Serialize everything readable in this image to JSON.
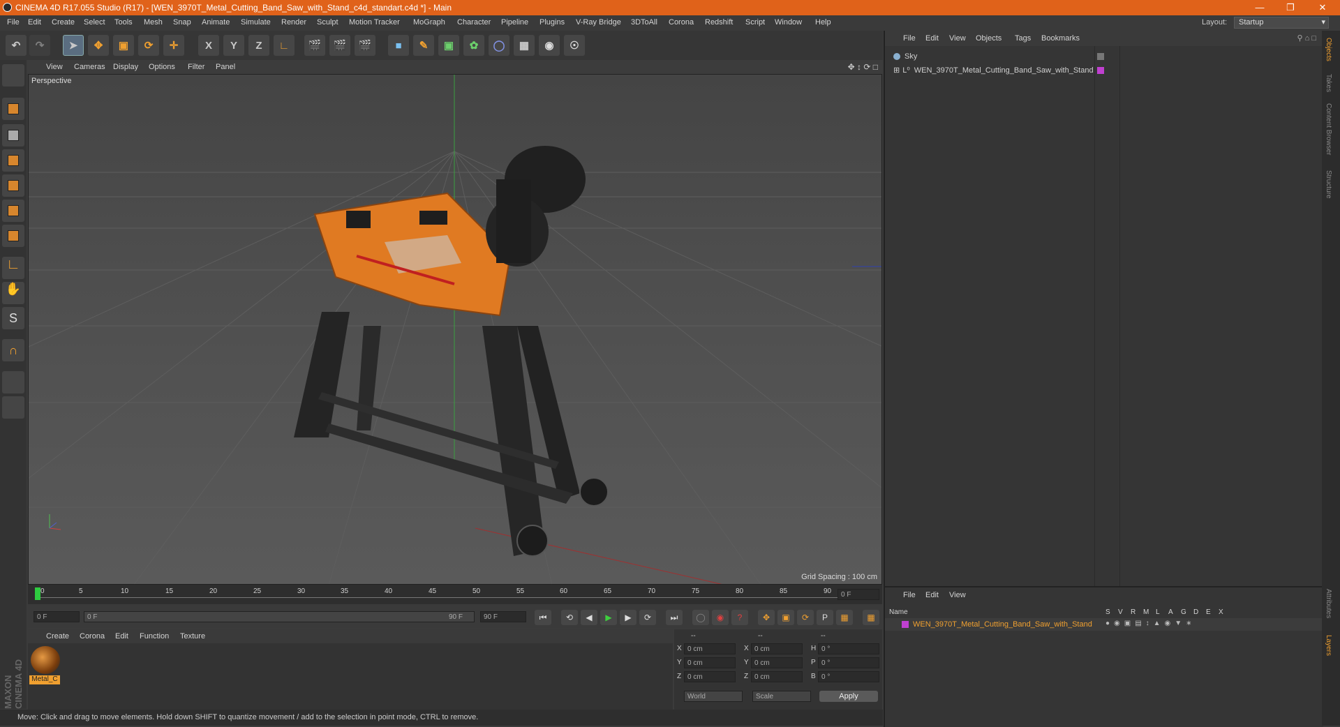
{
  "titlebar": {
    "title": "CINEMA 4D R17.055 Studio (R17) - [WEN_3970T_Metal_Cutting_Band_Saw_with_Stand_c4d_standart.c4d *] - Main",
    "accent": "#e0621a"
  },
  "menubar": {
    "items": [
      "File",
      "Edit",
      "Create",
      "Select",
      "Tools",
      "Mesh",
      "Snap",
      "Animate",
      "Simulate",
      "Render",
      "Sculpt",
      "Motion Tracker",
      "MoGraph",
      "Character",
      "Pipeline",
      "Plugins",
      "V-Ray Bridge",
      "3DToAll",
      "Corona",
      "Redshift",
      "Script",
      "Window",
      "Help"
    ],
    "layout_label": "Layout:",
    "layout_value": "Startup"
  },
  "toolbar": {
    "axis_x": "X",
    "axis_y": "Y",
    "axis_z": "Z"
  },
  "viewport": {
    "menu": [
      "View",
      "Cameras",
      "Display",
      "Options",
      "Filter",
      "Panel"
    ],
    "label": "Perspective",
    "grid_spacing": "Grid Spacing : 100 cm"
  },
  "timeline": {
    "ticks": [
      "0",
      "5",
      "10",
      "15",
      "20",
      "25",
      "30",
      "35",
      "40",
      "45",
      "50",
      "55",
      "60",
      "65",
      "70",
      "75",
      "80",
      "85",
      "90"
    ],
    "current_frame": "0 F",
    "start_field": "0 F",
    "range_start": "0 F",
    "range_end": "90 F",
    "end_field": "90 F"
  },
  "material_panel": {
    "menu": [
      "Create",
      "Corona",
      "Edit",
      "Function",
      "Texture"
    ],
    "material_name": "Metal_C"
  },
  "coords_panel": {
    "header": [
      "--",
      "--",
      "--"
    ],
    "rows": [
      {
        "a": "X",
        "av": "0 cm",
        "b": "X",
        "bv": "0 cm",
        "c": "H",
        "cv": "0 °"
      },
      {
        "a": "Y",
        "av": "0 cm",
        "b": "Y",
        "bv": "0 cm",
        "c": "P",
        "cv": "0 °"
      },
      {
        "a": "Z",
        "av": "0 cm",
        "b": "Z",
        "bv": "0 cm",
        "c": "B",
        "cv": "0 °"
      }
    ],
    "world": "World",
    "scale": "Scale",
    "apply": "Apply"
  },
  "statusbar": {
    "text": "Move: Click and drag to move elements. Hold down SHIFT to quantize movement / add to the selection in point mode, CTRL to remove."
  },
  "object_manager": {
    "menu": [
      "File",
      "Edit",
      "View",
      "Objects",
      "Tags",
      "Bookmarks"
    ],
    "objects": [
      "Sky",
      "WEN_3970T_Metal_Cutting_Band_Saw_with_Stand"
    ]
  },
  "layer_manager": {
    "menu": [
      "File",
      "Edit",
      "View"
    ],
    "header_name": "Name",
    "columns": [
      "S",
      "V",
      "R",
      "M",
      "L",
      "A",
      "G",
      "D",
      "E",
      "X"
    ],
    "layer_name": "WEN_3970T_Metal_Cutting_Band_Saw_with_Stand"
  },
  "right_tabs": [
    "Objects",
    "Takes",
    "Content Browser",
    "Structure",
    "Attributes",
    "Layers"
  ],
  "brand": "MAXON CINEMA 4D"
}
